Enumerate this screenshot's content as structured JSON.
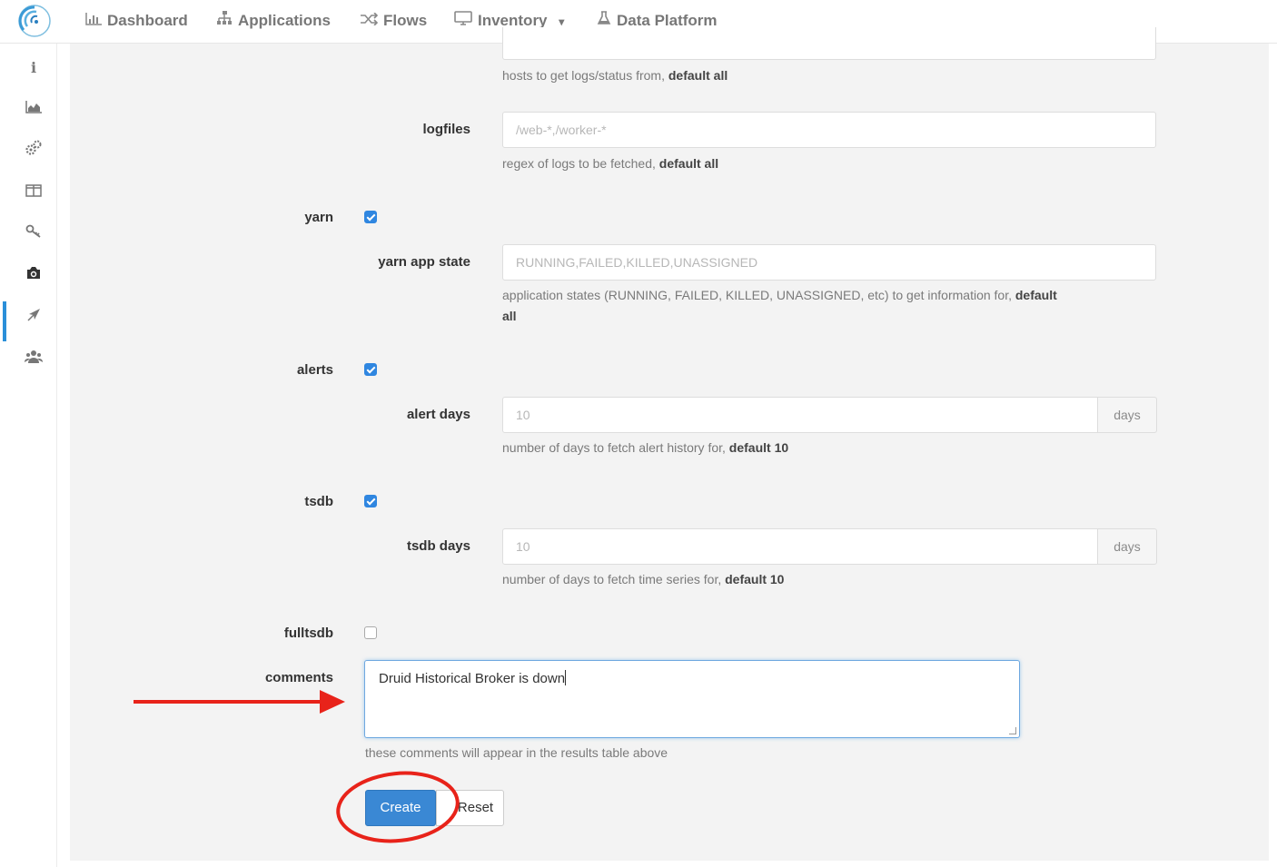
{
  "nav": {
    "items": [
      {
        "label": "Dashboard",
        "icon": "bar-chart-icon"
      },
      {
        "label": "Applications",
        "icon": "sitemap-icon"
      },
      {
        "label": "Flows",
        "icon": "random-icon"
      },
      {
        "label": "Inventory",
        "icon": "desktop-icon"
      },
      {
        "label": "Data Platform",
        "icon": "flask-icon"
      }
    ],
    "inventory_caret": "▾"
  },
  "sidebar": {
    "icons": [
      "info-icon",
      "area-chart-icon",
      "cogs-icon",
      "columns-icon",
      "key-icon",
      "camera-icon",
      "rocket-icon",
      "users-icon"
    ],
    "glyphs": [
      "i",
      "▟",
      "⚙",
      "◫",
      "⚿",
      "◉",
      "➤",
      "👥"
    ],
    "active_index": 5
  },
  "form": {
    "hosts_help": "hosts to get logs/status from, ",
    "hosts_help_default": "default all",
    "logfiles": {
      "label": "logfiles",
      "placeholder": "/web-*,/worker-*",
      "help": "regex of logs to be fetched, ",
      "help_default": "default all"
    },
    "yarn": {
      "label": "yarn",
      "checked": true,
      "state_label": "yarn app state",
      "state_placeholder": "RUNNING,FAILED,KILLED,UNASSIGNED",
      "help_line1": "application states (RUNNING, FAILED, KILLED, UNASSIGNED, etc) to get information for, ",
      "help_default1": "default",
      "help_line2": "all"
    },
    "alerts": {
      "label": "alerts",
      "checked": true,
      "days_label": "alert days",
      "days_placeholder": "10",
      "addon": "days",
      "help": "number of days to fetch alert history for, ",
      "help_default": "default 10"
    },
    "tsdb": {
      "label": "tsdb",
      "checked": true,
      "days_label": "tsdb days",
      "days_placeholder": "10",
      "addon": "days",
      "help": "number of days to fetch time series for, ",
      "help_default": "default 10"
    },
    "fulltsdb": {
      "label": "fulltsdb",
      "checked": false
    },
    "comments": {
      "label": "comments",
      "value": "Druid Historical Broker is down",
      "help": "these comments will appear in the results table above"
    },
    "create_label": "Create",
    "reset_label": "Reset"
  },
  "annotation": {
    "color": "#e8231a"
  },
  "colors": {
    "accent": "#3a88d4",
    "checkbox": "#2f86e0",
    "panel_bg": "#f3f3f3"
  }
}
